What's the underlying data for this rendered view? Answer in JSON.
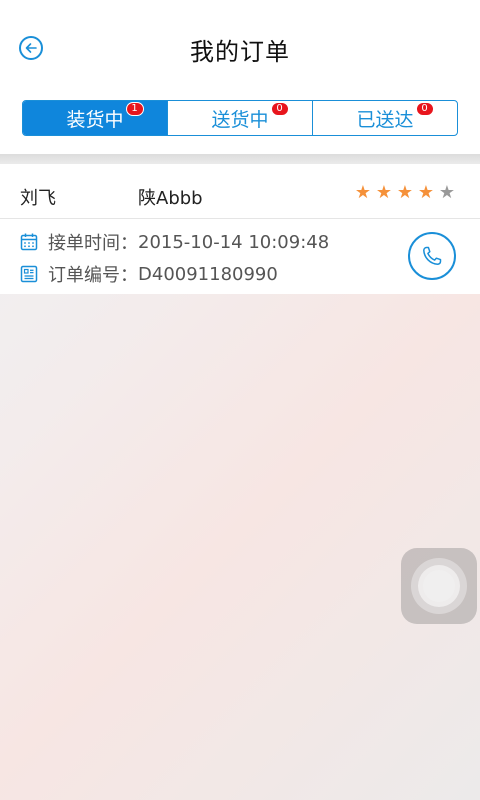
{
  "header": {
    "title": "我的订单",
    "back_icon": "back-arrow-icon"
  },
  "tabs": [
    {
      "label": "装货中",
      "badge": "1",
      "active": true
    },
    {
      "label": "送货中",
      "badge": "0",
      "active": false
    },
    {
      "label": "已送达",
      "badge": "0",
      "active": false
    }
  ],
  "order": {
    "driver": "刘飞",
    "plate": "陕Abbb",
    "rating": 4,
    "rating_max": 5,
    "time_label": "接单时间：",
    "time_value": "2015-10-14 10:09:48",
    "number_label": "订单编号：",
    "number_value": "D40091180990"
  },
  "colors": {
    "accent": "#1a8fd8",
    "tab_active_bg": "#0f86dc",
    "badge": "#e8151d",
    "star_on": "#f5913a",
    "star_off": "#999999"
  }
}
